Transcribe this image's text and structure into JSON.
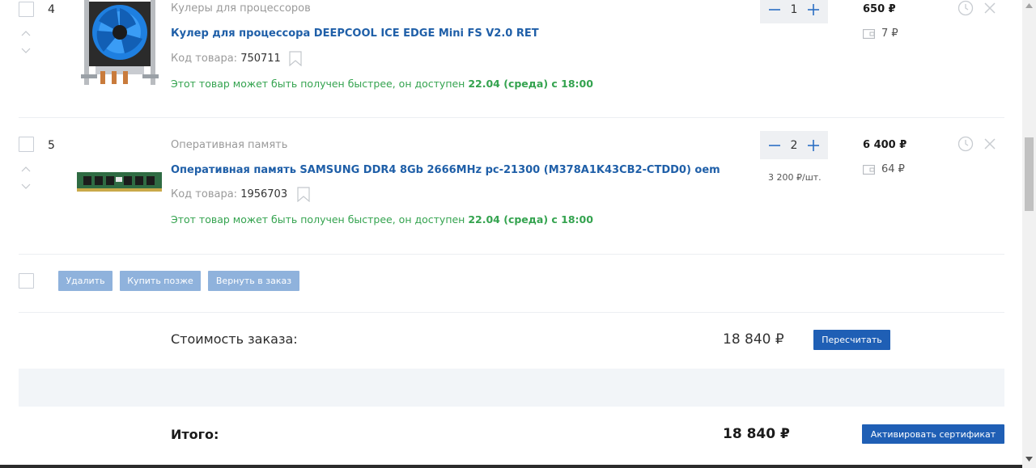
{
  "items": [
    {
      "index": "4",
      "category": "Кулеры для процессоров",
      "title": "Кулер для процессора DEEPCOOL ICE EDGE Mini FS V2.0 RET",
      "code_label": "Код товара:",
      "code": "750711",
      "availability_prefix": "Этот товар может быть получен быстрее, он доступен",
      "availability_date": "22.04 (среда) с 18:00",
      "quantity": "1",
      "unit_price": "",
      "price": "650 ₽",
      "bonus": "7 ₽"
    },
    {
      "index": "5",
      "category": "Оперативная память",
      "title": "Оперативная память SAMSUNG DDR4 8Gb 2666MHz pc-21300 (M378A1K43CB2-CTDD0) oem",
      "code_label": "Код товара:",
      "code": "1956703",
      "availability_prefix": "Этот товар может быть получен быстрее, он доступен",
      "availability_date": "22.04 (среда) с 18:00",
      "quantity": "2",
      "unit_price": "3 200 ₽/шт.",
      "price": "6 400 ₽",
      "bonus": "64 ₽"
    }
  ],
  "actions": {
    "delete_label": "Удалить",
    "buy_later_label": "Купить позже",
    "return_label": "Вернуть в заказ"
  },
  "summary": {
    "cost_label": "Стоимость заказа:",
    "cost_value": "18 840 ₽",
    "recalc_label": "Пересчитать",
    "total_label": "Итого:",
    "total_value": "18 840 ₽",
    "certificate_label": "Активировать сертификат"
  },
  "colors": {
    "link_blue": "#1f5fa8",
    "button_blue": "#1f5fb5",
    "button_light": "#8fb2dc",
    "availability_green": "#34a34f",
    "qty_bg": "#eef0f3",
    "band_bg": "#f2f5f8"
  },
  "icons": [
    "chevron-up-icon",
    "chevron-down-icon",
    "bookmark-icon",
    "minus-icon",
    "plus-icon",
    "wallet-icon",
    "clock-icon",
    "close-icon"
  ]
}
